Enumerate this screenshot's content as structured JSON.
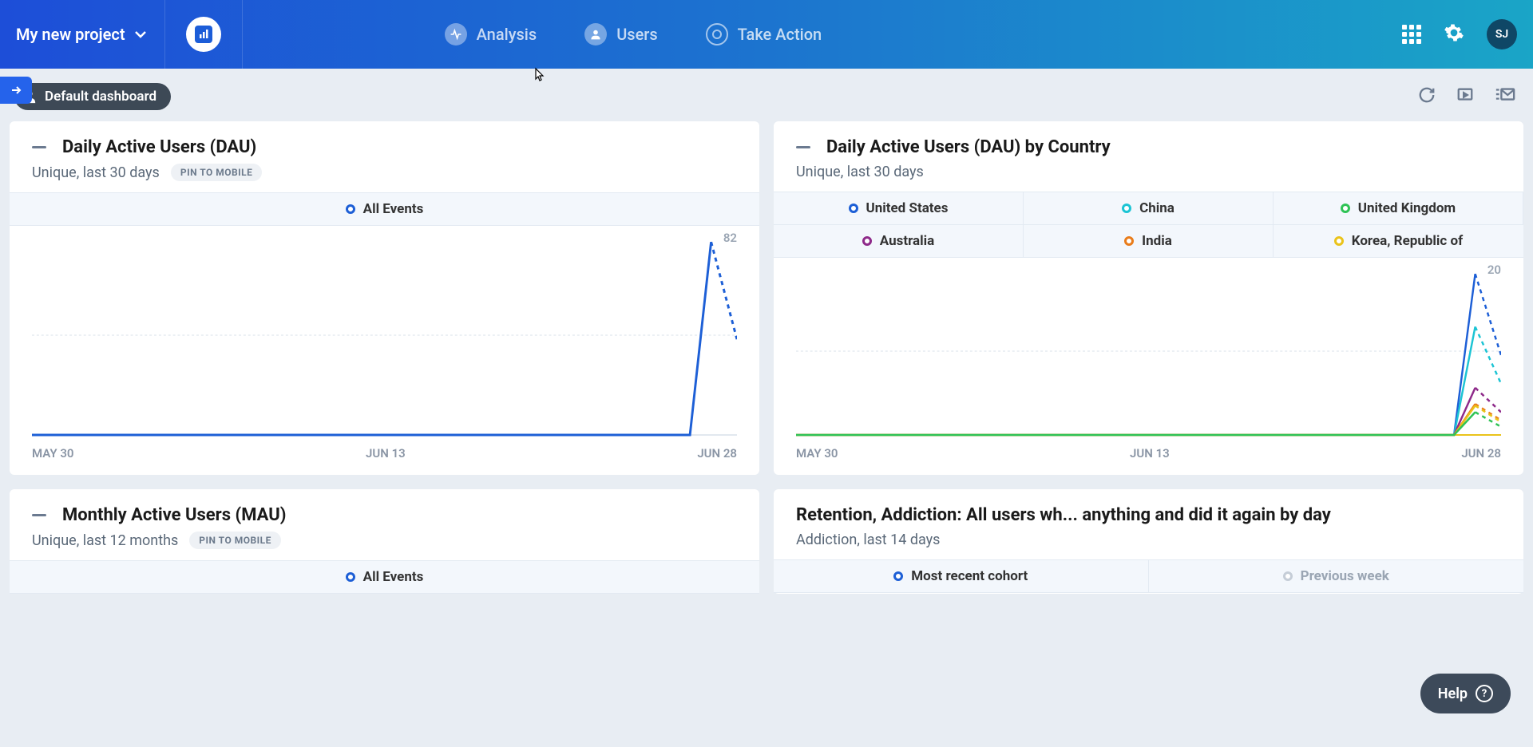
{
  "header": {
    "project_name": "My new project",
    "nav": [
      {
        "label": "Analysis",
        "icon": "pulse"
      },
      {
        "label": "Users",
        "icon": "user"
      },
      {
        "label": "Take Action",
        "icon": "target"
      }
    ],
    "avatar_initials": "SJ"
  },
  "toolbar": {
    "dashboard_label": "Default dashboard"
  },
  "cards": [
    {
      "title": "Daily Active Users (DAU)",
      "subtitle": "Unique, last 30 days",
      "pin_label": "PIN TO MOBILE",
      "legend": [
        {
          "label": "All Events",
          "color": "#1d5fd6"
        }
      ],
      "ymax_label": "82",
      "xaxis": [
        "MAY 30",
        "JUN 13",
        "JUN 28"
      ]
    },
    {
      "title": "Daily Active Users (DAU) by Country",
      "subtitle": "Unique, last 30 days",
      "legend": [
        {
          "label": "United States",
          "color": "#1d5fd6"
        },
        {
          "label": "China",
          "color": "#1cc4d4"
        },
        {
          "label": "United Kingdom",
          "color": "#2fc356"
        },
        {
          "label": "Australia",
          "color": "#8e2a8a"
        },
        {
          "label": "India",
          "color": "#e97c1a"
        },
        {
          "label": "Korea, Republic of",
          "color": "#eac31a"
        }
      ],
      "ymax_label": "20",
      "xaxis": [
        "MAY 30",
        "JUN 13",
        "JUN 28"
      ]
    },
    {
      "title": "Monthly Active Users (MAU)",
      "subtitle": "Unique, last 12 months",
      "pin_label": "PIN TO MOBILE",
      "legend": [
        {
          "label": "All Events",
          "color": "#1d5fd6"
        }
      ]
    },
    {
      "title": "Retention, Addiction: All users wh... anything and did it again by day",
      "subtitle": "Addiction, last 14 days",
      "legend": [
        {
          "label": "Most recent cohort",
          "color": "#1d5fd6"
        },
        {
          "label": "Previous week",
          "color": "#9aa5b3"
        }
      ]
    }
  ],
  "help_label": "Help",
  "chart_data": [
    {
      "type": "line",
      "title": "Daily Active Users (DAU)",
      "xlabel": "",
      "ylabel": "",
      "ylim": [
        0,
        82
      ],
      "x_range": [
        "MAY 30",
        "JUN 28"
      ],
      "x_ticks": [
        "MAY 30",
        "JUN 13",
        "JUN 28"
      ],
      "series": [
        {
          "name": "All Events",
          "color": "#1d5fd6",
          "points": [
            {
              "x": "MAY 30",
              "y": 0
            },
            {
              "x": "JUN 25",
              "y": 0
            },
            {
              "x": "JUN 26",
              "y": 82
            },
            {
              "x": "JUN 28",
              "y": 38,
              "projected": true
            }
          ]
        }
      ]
    },
    {
      "type": "line",
      "title": "Daily Active Users (DAU) by Country",
      "xlabel": "",
      "ylabel": "",
      "ylim": [
        0,
        20
      ],
      "x_range": [
        "MAY 30",
        "JUN 28"
      ],
      "x_ticks": [
        "MAY 30",
        "JUN 13",
        "JUN 28"
      ],
      "series": [
        {
          "name": "United States",
          "color": "#1d5fd6",
          "points": [
            {
              "x": "MAY 30",
              "y": 0
            },
            {
              "x": "JUN 25",
              "y": 0
            },
            {
              "x": "JUN 26",
              "y": 20
            },
            {
              "x": "JUN 28",
              "y": 10,
              "projected": true
            }
          ]
        },
        {
          "name": "China",
          "color": "#1cc4d4",
          "points": [
            {
              "x": "MAY 30",
              "y": 0
            },
            {
              "x": "JUN 25",
              "y": 0
            },
            {
              "x": "JUN 26",
              "y": 13
            },
            {
              "x": "JUN 28",
              "y": 6,
              "projected": true
            }
          ]
        },
        {
          "name": "Australia",
          "color": "#8e2a8a",
          "points": [
            {
              "x": "MAY 30",
              "y": 0
            },
            {
              "x": "JUN 25",
              "y": 0
            },
            {
              "x": "JUN 26",
              "y": 6
            },
            {
              "x": "JUN 28",
              "y": 3,
              "projected": true
            }
          ]
        },
        {
          "name": "India",
          "color": "#e97c1a",
          "points": [
            {
              "x": "MAY 30",
              "y": 0
            },
            {
              "x": "JUN 25",
              "y": 0
            },
            {
              "x": "JUN 26",
              "y": 4
            },
            {
              "x": "JUN 28",
              "y": 2,
              "projected": true
            }
          ]
        },
        {
          "name": "Korea, Republic of",
          "color": "#eac31a",
          "points": [
            {
              "x": "MAY 30",
              "y": 0
            },
            {
              "x": "JUN 25",
              "y": 0
            },
            {
              "x": "JUN 26",
              "y": 4
            },
            {
              "x": "JUN 28",
              "y": 2,
              "projected": true
            }
          ]
        },
        {
          "name": "United Kingdom",
          "color": "#2fc356",
          "points": [
            {
              "x": "MAY 30",
              "y": 0
            },
            {
              "x": "JUN 25",
              "y": 0
            },
            {
              "x": "JUN 26",
              "y": 3
            },
            {
              "x": "JUN 28",
              "y": 1,
              "projected": true
            }
          ]
        }
      ]
    }
  ]
}
